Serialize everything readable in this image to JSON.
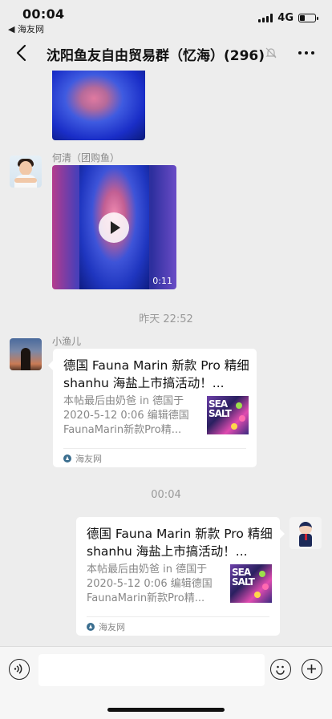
{
  "status_bar": {
    "time": "00:04",
    "back_app": "◀ 海友网",
    "network": "4G",
    "battery_level": 0.35
  },
  "nav": {
    "title": "沈阳鱼友自由贸易群（忆海）(296)"
  },
  "messages": [
    {
      "sender": "何清（团购鱼）",
      "video_duration": "0:11"
    },
    {
      "timestamp": "昨天 22:52"
    },
    {
      "sender": "小渔儿",
      "link": {
        "title": "德国 Fauna Marin 新款 Pro 精细 shanhu 海盐上市搞活动！...",
        "description": "本帖最后由奶爸 in 德国于 2020-5-12 0:06 编辑德国 FaunaMarin新款Pro精...",
        "thumb_text": "SEA SALT",
        "source": "海友网"
      }
    },
    {
      "timestamp": "00:04"
    },
    {
      "sender": "me",
      "link": {
        "title": "德国 Fauna Marin 新款 Pro 精细 shanhu 海盐上市搞活动！...",
        "description": "本帖最后由奶爸 in 德国于 2020-5-12 0:06 编辑德国 FaunaMarin新款Pro精...",
        "thumb_text": "SEA SALT",
        "source": "海友网"
      }
    }
  ],
  "input": {
    "placeholder": ""
  }
}
